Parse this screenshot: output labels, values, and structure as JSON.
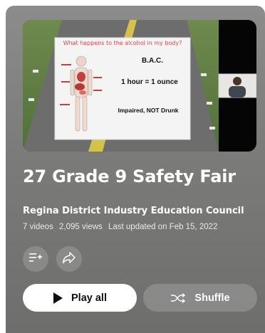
{
  "thumbnail": {
    "slide_heading": "What happens to the alcohol in my body?",
    "line1": "B.A.C.",
    "line2": "1 hour = 1 ounce",
    "line3": "Impaired, NOT Drunk"
  },
  "playlist": {
    "title": "27 Grade 9 Safety Fair",
    "channel": "Regina District Industry Education Council",
    "video_count": "7 videos",
    "views": "2,095 views",
    "updated": "Last updated on Feb 15, 2022"
  },
  "actions": {
    "save_icon": "playlist-add-icon",
    "share_icon": "share-icon",
    "play_all_label": "Play all",
    "shuffle_label": "Shuffle"
  },
  "colors": {
    "slide_heading": "#e0434b",
    "background": "#7b7b79"
  }
}
